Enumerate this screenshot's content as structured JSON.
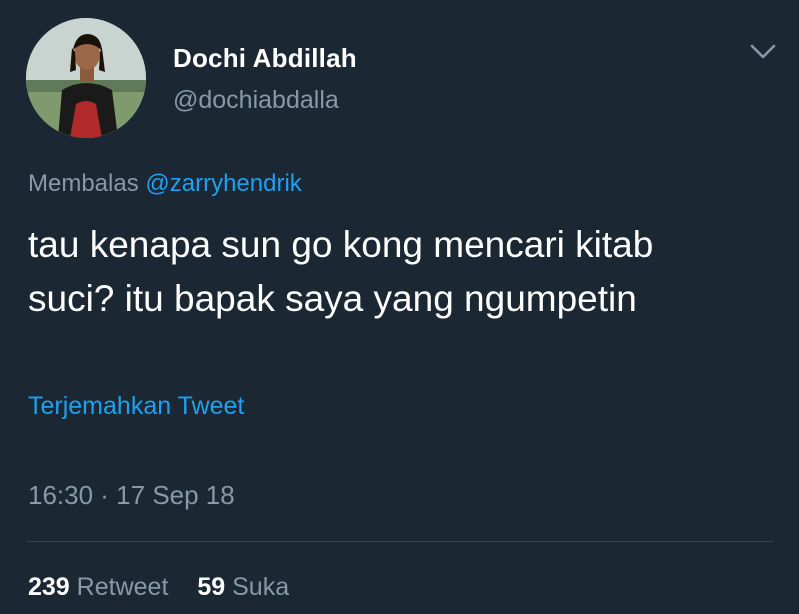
{
  "user": {
    "name": "Dochi Abdillah",
    "handle": "@dochiabdalla"
  },
  "reply": {
    "prefix": "Membalas",
    "mention": "@zarryhendrik"
  },
  "tweet": {
    "text_line1": "tau kenapa sun go kong mencari kitab",
    "text_line2": "suci? itu bapak saya yang ngumpetin"
  },
  "translate_label": "Terjemahkan Tweet",
  "timestamp": "16:30 · 17 Sep 18",
  "stats": {
    "retweets_count": "239",
    "retweets_label": "Retweet",
    "likes_count": "59",
    "likes_label": "Suka"
  },
  "colors": {
    "background": "#1c2734",
    "accent": "#1da1f2",
    "secondary_text": "#8899a6",
    "divider": "#38444d"
  },
  "icons": {
    "menu": "chevron-down-icon"
  }
}
